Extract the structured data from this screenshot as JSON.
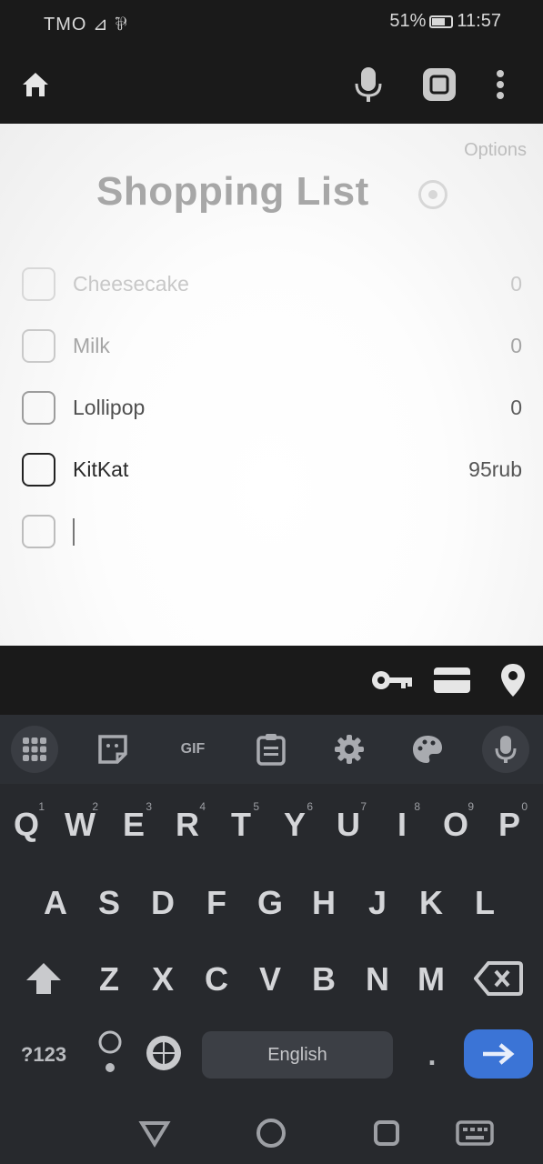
{
  "status_bar": {
    "left_text": "TMO ⊿ ⅌",
    "battery_text": "51%",
    "time": "11:57"
  },
  "toolbar": {
    "icons": [
      "home-icon",
      "microphone-icon",
      "scan-icon",
      "more-vert-icon"
    ]
  },
  "main": {
    "options_label": "Options",
    "title": "Shopping List",
    "title_icon": "settings-circle-icon",
    "items": [
      {
        "name": "Cheesecake",
        "price": "0",
        "checked": false
      },
      {
        "name": "Milk",
        "price": "0",
        "checked": false
      },
      {
        "name": "Lollipop",
        "price": "0",
        "checked": false
      },
      {
        "name": "KitKat",
        "price": "95rub",
        "checked": false
      }
    ],
    "new_item": {
      "value": "",
      "placeholder": ""
    }
  },
  "autofill_strip": {
    "icons": [
      "key-icon",
      "credit-card-icon",
      "location-pin-icon"
    ]
  },
  "keyboard": {
    "toolbar": {
      "gif_label": "GIF",
      "icons": [
        "apps-grid-icon",
        "sticker-icon",
        "gif-icon",
        "clipboard-icon",
        "settings-icon",
        "palette-icon",
        "microphone-icon"
      ]
    },
    "row1": [
      {
        "label": "Q",
        "hint": "1"
      },
      {
        "label": "W",
        "hint": "2"
      },
      {
        "label": "E",
        "hint": "3"
      },
      {
        "label": "R",
        "hint": "4"
      },
      {
        "label": "T",
        "hint": "5"
      },
      {
        "label": "Y",
        "hint": "6"
      },
      {
        "label": "U",
        "hint": "7"
      },
      {
        "label": "I",
        "hint": "8"
      },
      {
        "label": "O",
        "hint": "9"
      },
      {
        "label": "P",
        "hint": "0"
      }
    ],
    "row2": [
      "A",
      "S",
      "D",
      "F",
      "G",
      "H",
      "J",
      "K",
      "L"
    ],
    "row3": [
      "Z",
      "X",
      "C",
      "V",
      "B",
      "N",
      "M"
    ],
    "symbols_label": "?123",
    "space_label": "English",
    "period_label": "."
  },
  "nav_bar": {
    "icons": [
      "back-triangle-icon",
      "home-circle-icon",
      "recents-square-icon",
      "keyboard-switch-icon"
    ]
  },
  "colors": {
    "accent_enter": "#3b74d6",
    "keyboard_bg": "#27292d",
    "toolbar_bg": "#1a1a1a"
  }
}
